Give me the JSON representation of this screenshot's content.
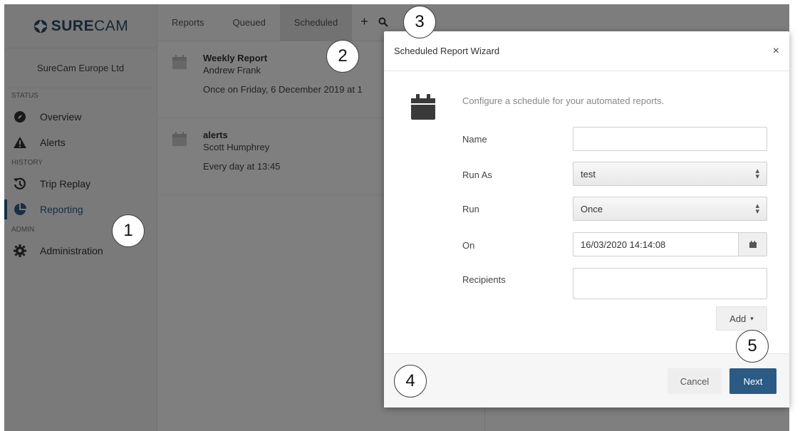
{
  "app": {
    "logo_text_bold": "SURE",
    "logo_text_light": "CAM",
    "company": "SureCam Europe Ltd"
  },
  "sidebar": {
    "sections": [
      {
        "label": "STATUS",
        "items": [
          {
            "label": "Overview",
            "icon": "compass-icon"
          },
          {
            "label": "Alerts",
            "icon": "warning-icon"
          }
        ]
      },
      {
        "label": "HISTORY",
        "items": [
          {
            "label": "Trip Replay",
            "icon": "history-icon"
          },
          {
            "label": "Reporting",
            "icon": "pie-chart-icon",
            "active": true
          }
        ]
      },
      {
        "label": "ADMIN",
        "items": [
          {
            "label": "Administration",
            "icon": "gear-icon"
          }
        ]
      }
    ]
  },
  "tabs": [
    {
      "label": "Reports"
    },
    {
      "label": "Queued"
    },
    {
      "label": "Scheduled",
      "active": true
    }
  ],
  "tab_tools": {
    "add": "+",
    "search_icon": "search-icon"
  },
  "reports": [
    {
      "title": "Weekly Report",
      "owner": "Andrew Frank",
      "schedule": "Once on Friday, 6 December 2019 at 1"
    },
    {
      "title": "alerts",
      "owner": "Scott Humphrey",
      "schedule": "Every day at 13:45"
    }
  ],
  "modal": {
    "title": "Scheduled Report Wizard",
    "close": "×",
    "intro": "Configure a schedule for your automated reports.",
    "fields": {
      "name_label": "Name",
      "name_value": "",
      "run_as_label": "Run As",
      "run_as_value": "test",
      "run_label": "Run",
      "run_value": "Once",
      "on_label": "On",
      "on_value": "16/03/2020 14:14:08",
      "recipients_label": "Recipients",
      "recipients_value": ""
    },
    "add_label": "Add",
    "cancel_label": "Cancel",
    "next_label": "Next"
  },
  "callouts": [
    "1",
    "2",
    "3",
    "4",
    "5"
  ],
  "colors": {
    "brand": "#2c4d66",
    "accent": "#2b5b84",
    "overlay": "rgba(0,0,0,0.5)"
  }
}
